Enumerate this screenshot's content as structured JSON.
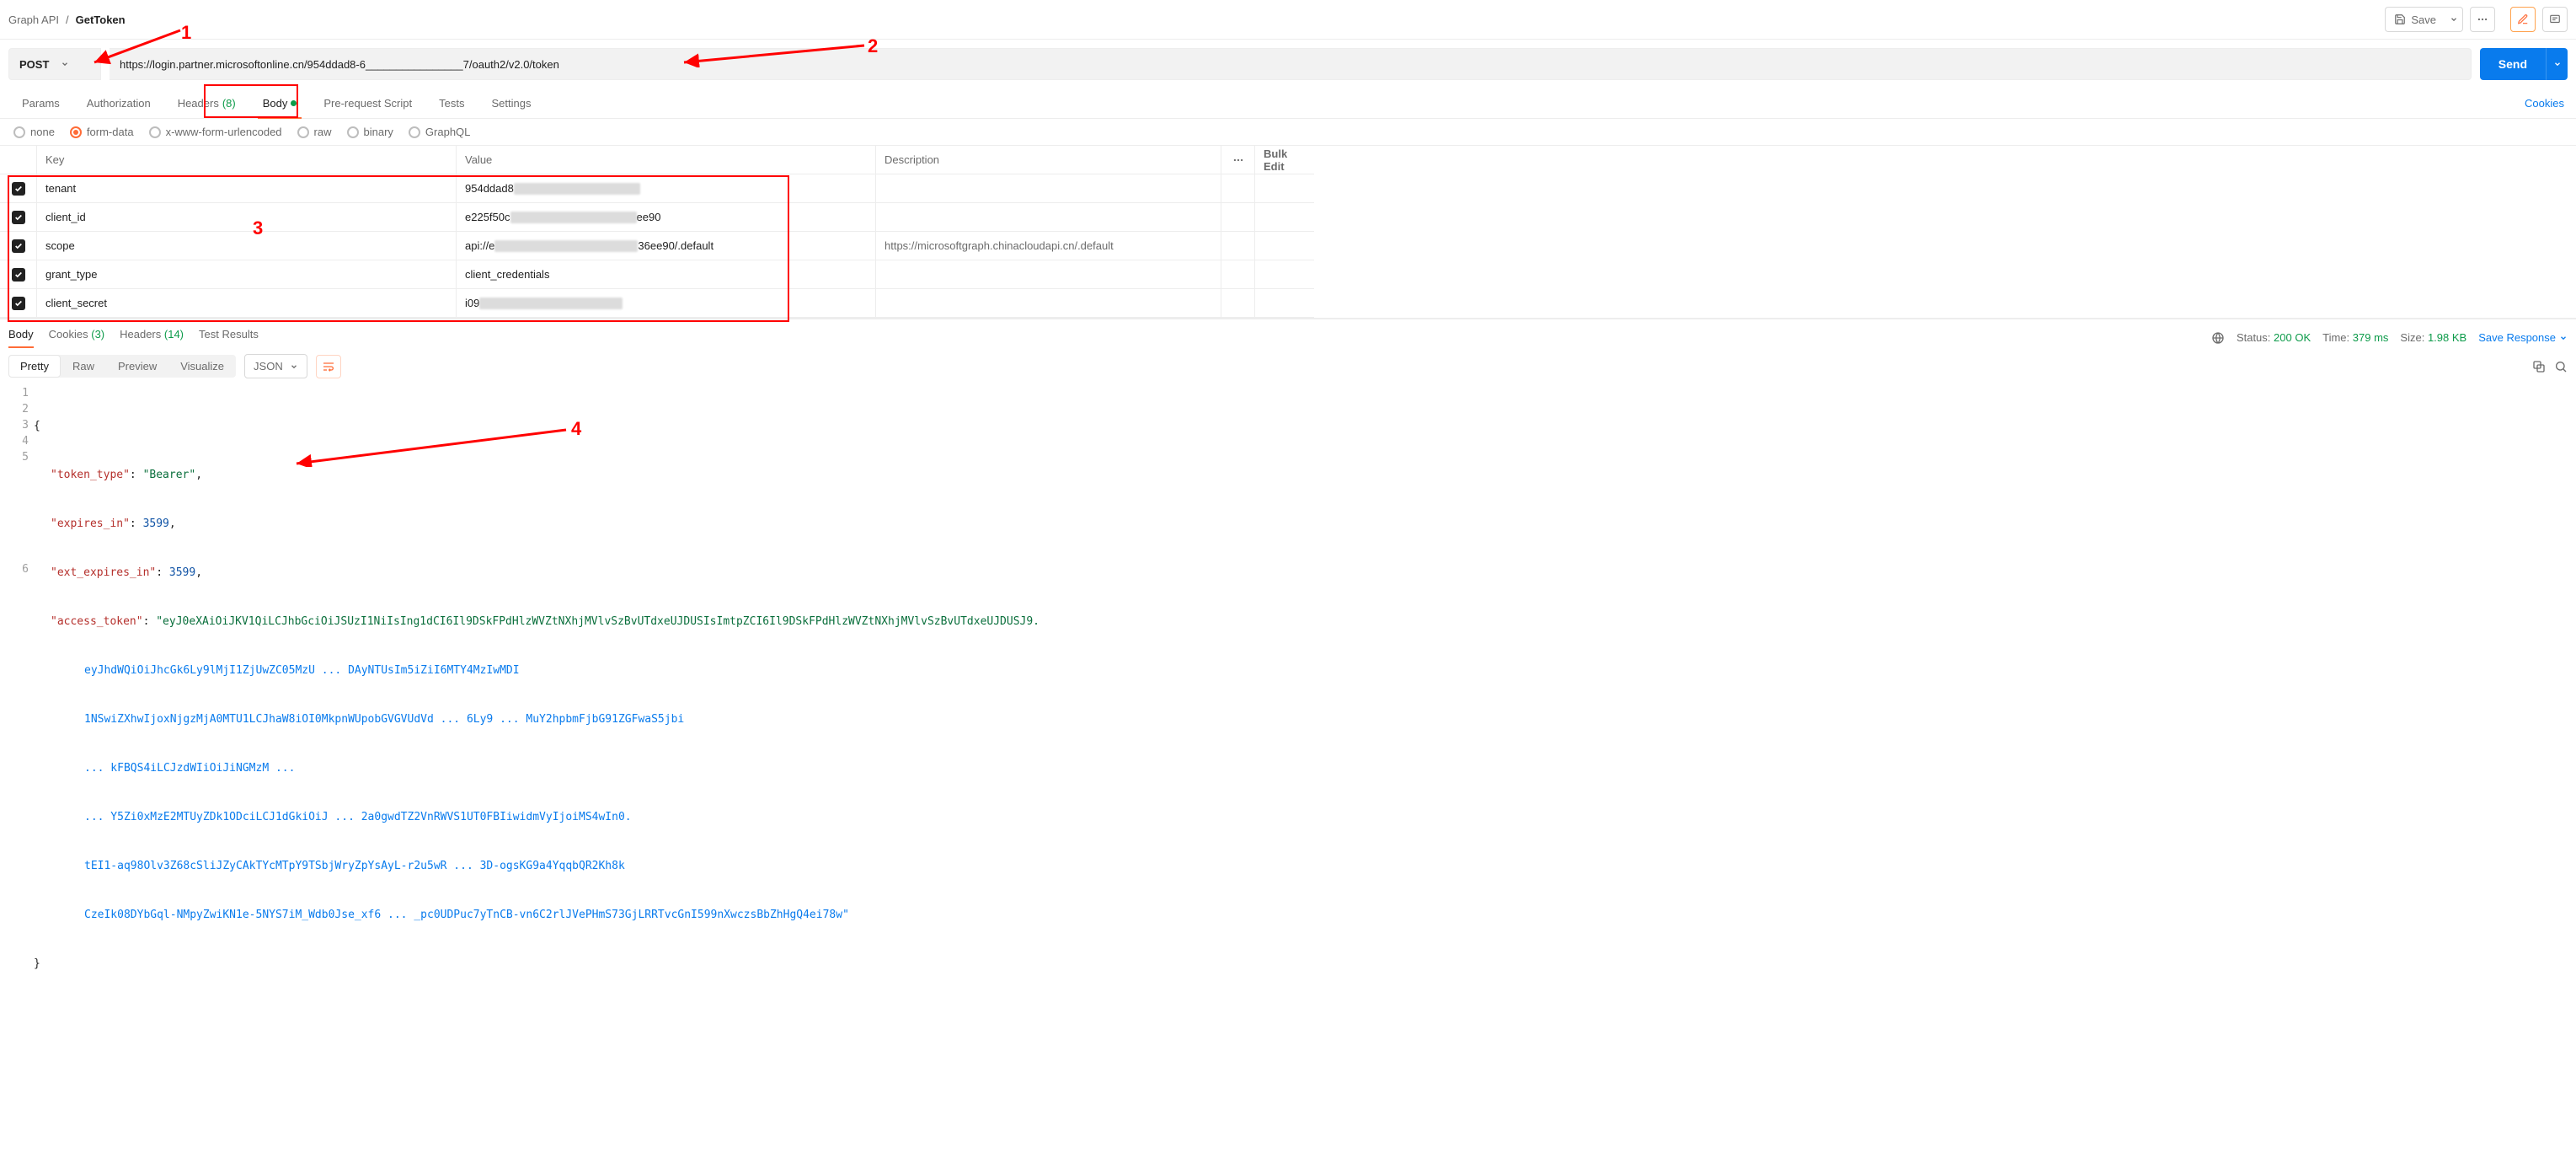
{
  "breadcrumb": {
    "parent": "Graph API",
    "current": "GetToken"
  },
  "toolbar": {
    "save": "Save"
  },
  "request": {
    "method": "POST",
    "url": "https://login.partner.microsoftonline.cn/954ddad8-6________________7/oauth2/v2.0/token",
    "send": "Send"
  },
  "tabs": {
    "params": "Params",
    "authorization": "Authorization",
    "headers": "Headers",
    "headers_count": "(8)",
    "body": "Body",
    "prerequest": "Pre-request Script",
    "tests": "Tests",
    "settings": "Settings",
    "cookies": "Cookies"
  },
  "body_types": {
    "none": "none",
    "formdata": "form-data",
    "urlencoded": "x-www-form-urlencoded",
    "raw": "raw",
    "binary": "binary",
    "graphql": "GraphQL"
  },
  "kv": {
    "head_key": "Key",
    "head_value": "Value",
    "head_desc": "Description",
    "bulk": "Bulk Edit",
    "rows": [
      {
        "key": "tenant",
        "value_prefix": "954ddad8",
        "value_suffix": "",
        "desc": ""
      },
      {
        "key": "client_id",
        "value_prefix": "e225f50c",
        "value_suffix": "ee90",
        "desc": ""
      },
      {
        "key": "scope",
        "value_prefix": "api://e",
        "value_suffix": "36ee90/.default",
        "desc": "https://microsoftgraph.chinacloudapi.cn/.default"
      },
      {
        "key": "grant_type",
        "value_prefix": "client_credentials",
        "value_suffix": "",
        "desc": ""
      },
      {
        "key": "client_secret",
        "value_prefix": "i09",
        "value_suffix": "",
        "desc": ""
      }
    ]
  },
  "resp_tabs": {
    "body": "Body",
    "cookies": "Cookies",
    "cookies_count": "(3)",
    "headers": "Headers",
    "headers_count": "(14)",
    "tests": "Test Results"
  },
  "status": {
    "label_status": "Status:",
    "status_value": "200 OK",
    "label_time": "Time:",
    "time_value": "379 ms",
    "label_size": "Size:",
    "size_value": "1.98 KB",
    "save_response": "Save Response"
  },
  "view": {
    "pretty": "Pretty",
    "raw": "Raw",
    "preview": "Preview",
    "visualize": "Visualize",
    "format": "JSON"
  },
  "json": {
    "line1_open": "{",
    "token_type_k": "\"token_type\"",
    "token_type_v": "\"Bearer\"",
    "expires_in_k": "\"expires_in\"",
    "expires_in_v": "3599",
    "ext_expires_in_k": "\"ext_expires_in\"",
    "ext_expires_in_v": "3599",
    "access_token_k": "\"access_token\"",
    "access_token_start": "\"eyJ0eXAiOiJKV1QiLCJhbGciOiJSUzI1NiIsIng1dCI6Il9DSkFPdHlzWVZtNXhjMVlvSzBvUTdxeUJDUSIsImtpZCI6Il9DSkFPdHlzWVZtNXhjMVlvSzBvUTdxeUJDUSJ9.",
    "access_token_l2": "eyJhdWQiOiJhcGk6Ly9lMjI1ZjUwZC05MzU ... DAyNTUsIm5iZiI6MTY4MzIwMDI",
    "access_token_l3": "1NSwiZXhwIjoxNjgzMjA0MTU1LCJhaW8iOI0MkpnWUpobGVGVUdVd ... 6Ly9 ... MuY2hpbmFjbG91ZGFwaS5jbi",
    "access_token_l4": "... kFBQS4iLCJzdWIiOiJiNGMzM ... ",
    "access_token_l5": "... Y5Zi0xMzE2MTUyZDk1ODciLCJ1dGkiOiJ ... 2a0gwdTZ2VnRWVS1UT0FBIiwidmVyIjoiMS4wIn0.",
    "access_token_l6": "tEI1-aq98Olv3Z68cSliJZyCAkTYcMTpY9TSbjWryZpYsAyL-r2u5wR ... 3D-ogsKG9a4YqqbQR2Kh8k",
    "access_token_l7": "CzeIk08DYbGql-NMpyZwiKN1e-5NYS7iM_Wdb0Jse_xf6 ... _pc0UDPuc7yTnCB-vn6C2rlJVePHmS73GjLRRTvcGnI599nXwczsBbZhHgQ4ei78w\"",
    "line6_close": "}"
  },
  "annotations": {
    "n1": "1",
    "n2": "2",
    "n3": "3",
    "n4": "4"
  }
}
